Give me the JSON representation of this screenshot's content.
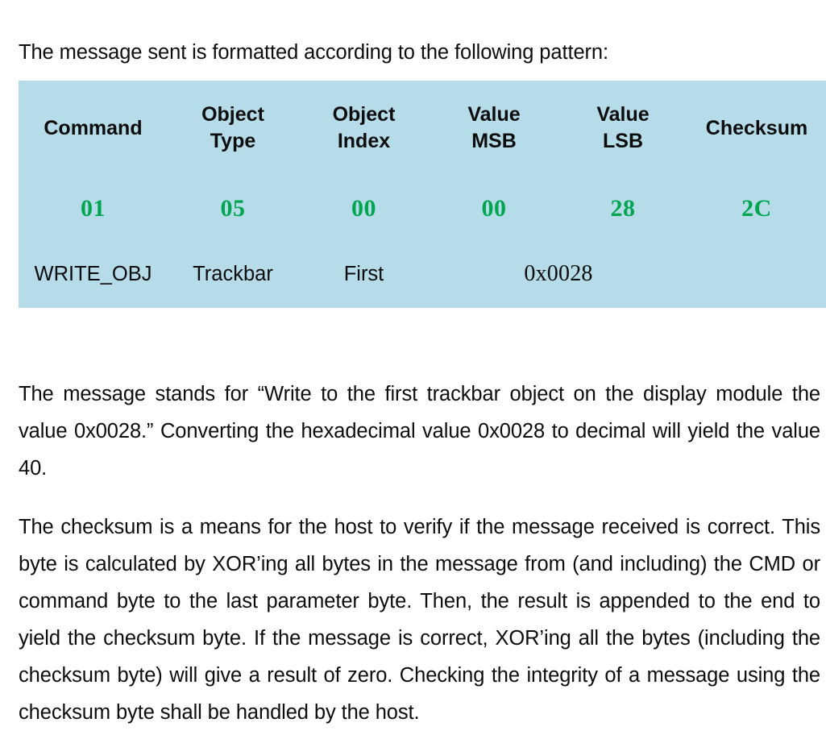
{
  "document": {
    "intro": "The message sent is formatted according to the following pattern:",
    "explanation": "The message stands for “Write to the first trackbar object on the display module the value 0x0028.” Converting the hexadecimal value 0x0028 to decimal will yield the value 40.",
    "checksum_note": "The checksum is a means for the host to verify if the message received is correct. This byte is calculated by XOR’ing all bytes in the message from (and including) the CMD or command byte to the last parameter byte. Then, the result is appended to the end to yield the checksum byte. If the message is correct, XOR’ing all the bytes (including the checksum byte) will give a result of zero. Checking the integrity of a message using the checksum byte shall be handled by the host."
  },
  "message_table": {
    "background_color": "#b5dce8",
    "hex_value_color": "#00a550",
    "text_color": "#0d0d0d",
    "headers": [
      {
        "line1": "Command",
        "line2": ""
      },
      {
        "line1": "Object",
        "line2": "Type"
      },
      {
        "line1": "Object",
        "line2": "Index"
      },
      {
        "line1": "Value",
        "line2": "MSB"
      },
      {
        "line1": "Value",
        "line2": "LSB"
      },
      {
        "line1": "Checksum",
        "line2": ""
      }
    ],
    "hex_bytes": [
      "01",
      "05",
      "00",
      "00",
      "28",
      "2C"
    ],
    "meanings": {
      "command": "WRITE_OBJ",
      "object_type": "Trackbar",
      "object_index": "First",
      "value": "0x0028",
      "checksum": ""
    }
  }
}
